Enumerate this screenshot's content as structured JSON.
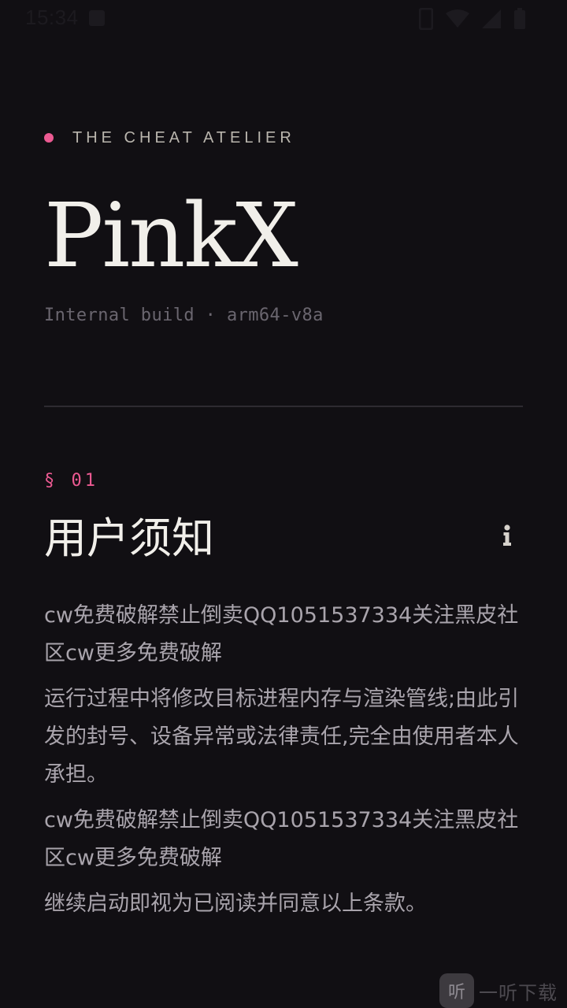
{
  "status_bar": {
    "time": "15:34",
    "a_icon": "a-badge-icon",
    "icons": [
      "phone-icon",
      "wifi-icon",
      "signal-icon",
      "battery-icon"
    ]
  },
  "brand": {
    "label": "THE CHEAT ATELIER",
    "accent_color": "#ec5a92"
  },
  "app": {
    "title": "PinkX",
    "build_info": "Internal build · arm64-v8a"
  },
  "section": {
    "number": "§ 01",
    "title": "用户须知",
    "info_icon": "info-icon"
  },
  "notice": {
    "paragraphs": [
      "cw免费破解禁止倒卖QQ1051537334关注黑皮社区cw更多免费破解",
      "运行过程中将修改目标进程内存与渲染管线;由此引发的封号、设备异常或法律责任,完全由使用者本人承担。",
      "cw免费破解禁止倒卖QQ1051537334关注黑皮社区cw更多免费破解",
      "继续启动即视为已阅读并同意以上条款。"
    ]
  },
  "watermark": {
    "badge": "听",
    "text": "一听下载"
  },
  "colors": {
    "background": "#110f13",
    "title": "#f1efea",
    "body_text": "#a9a4ac",
    "accent": "#ec5a92"
  }
}
